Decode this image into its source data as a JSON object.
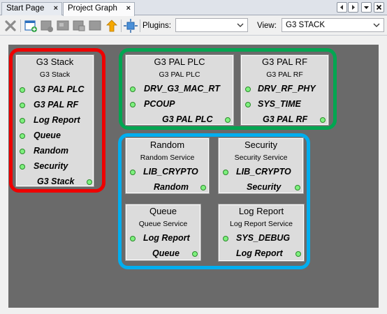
{
  "tabs": [
    {
      "label": "Start Page",
      "close": "×"
    },
    {
      "label": "Project Graph",
      "close": "×"
    }
  ],
  "toolbar": {
    "icons": [
      "delete-icon",
      "add-component-icon",
      "remove-component-icon",
      "collapse-icon",
      "group-icon",
      "move-up-icon",
      "auto-layout-icon"
    ],
    "plugins_label": "Plugins:",
    "plugins_value": "",
    "view_label": "View:",
    "view_value": "G3 STACK"
  },
  "colors": {
    "group_red": "#ee0000",
    "group_green": "#00a651",
    "group_blue": "#00aeef",
    "canvas": "#6a6a6a",
    "port_dot": "#7ef07e"
  },
  "nodes": {
    "g3stack": {
      "title": "G3 Stack",
      "subtitle": "G3 Stack",
      "deps": [
        "G3 PAL PLC",
        "G3 PAL RF",
        "Log Report",
        "Queue",
        "Random",
        "Security"
      ],
      "output": "G3 Stack"
    },
    "palplc": {
      "title": "G3 PAL PLC",
      "subtitle": "G3 PAL PLC",
      "deps": [
        "DRV_G3_MAC_RT",
        "PCOUP"
      ],
      "output": "G3 PAL PLC"
    },
    "palrf": {
      "title": "G3 PAL RF",
      "subtitle": "G3 PAL RF",
      "deps": [
        "DRV_RF_PHY",
        "SYS_TIME"
      ],
      "output": "G3 PAL RF"
    },
    "random": {
      "title": "Random",
      "subtitle": "Random Service",
      "deps": [
        "LIB_CRYPTO"
      ],
      "output": "Random"
    },
    "security": {
      "title": "Security",
      "subtitle": "Security Service",
      "deps": [
        "LIB_CRYPTO"
      ],
      "output": "Security"
    },
    "queue": {
      "title": "Queue",
      "subtitle": "Queue Service",
      "deps": [
        "Log Report"
      ],
      "output": "Queue"
    },
    "logreport": {
      "title": "Log Report",
      "subtitle": "Log Report Service",
      "deps": [
        "SYS_DEBUG"
      ],
      "output": "Log Report"
    }
  }
}
